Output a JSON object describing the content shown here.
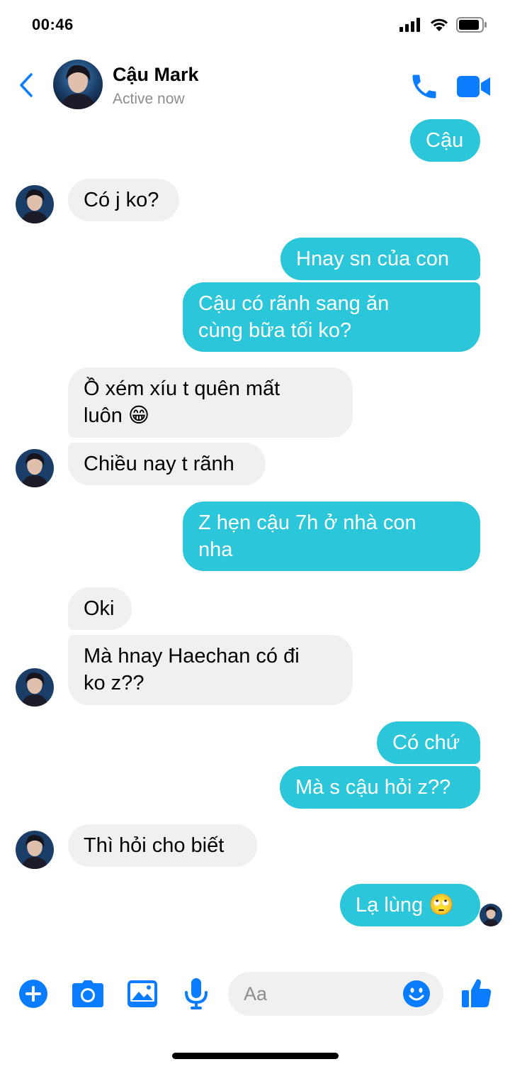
{
  "status_bar": {
    "time": "00:46"
  },
  "header": {
    "name": "Cậu Mark",
    "status": "Active now",
    "icons": {
      "back": "back-chevron-icon",
      "call": "phone-icon",
      "video": "video-camera-icon"
    }
  },
  "colors": {
    "accent": "#0a7cff",
    "outgoing": "#2bc6d9",
    "incoming": "#f0f0f0"
  },
  "messages": [
    {
      "sender": "me",
      "lines": [
        "Cậu"
      ]
    },
    {
      "sender": "them",
      "lines": [
        "Có j ko?"
      ]
    },
    {
      "sender": "me",
      "lines": [
        "Hnay sn của con"
      ]
    },
    {
      "sender": "me",
      "lines": [
        "Cậu có rãnh sang ăn",
        "cùng bữa tối ko?"
      ]
    },
    {
      "sender": "them",
      "lines": [
        "Ồ xém xíu t quên mất",
        "luôn 😁"
      ]
    },
    {
      "sender": "them",
      "lines": [
        "Chiều nay t rãnh"
      ]
    },
    {
      "sender": "me",
      "lines": [
        "Z hẹn cậu 7h ở nhà con",
        "nha"
      ]
    },
    {
      "sender": "them",
      "lines": [
        "Oki"
      ]
    },
    {
      "sender": "them",
      "lines": [
        "Mà hnay Haechan có đi",
        "ko z??"
      ]
    },
    {
      "sender": "me",
      "lines": [
        "Có chứ"
      ]
    },
    {
      "sender": "me",
      "lines": [
        "Mà s cậu hỏi z??"
      ]
    },
    {
      "sender": "them",
      "lines": [
        "Thì hỏi cho biết"
      ]
    },
    {
      "sender": "me",
      "lines": [
        "Lạ lùng 🙄"
      ]
    }
  ],
  "composer": {
    "placeholder": "Aa",
    "icons": [
      "plus-circle-icon",
      "camera-icon",
      "image-icon",
      "microphone-icon",
      "smiley-icon",
      "thumbs-up-icon"
    ]
  }
}
